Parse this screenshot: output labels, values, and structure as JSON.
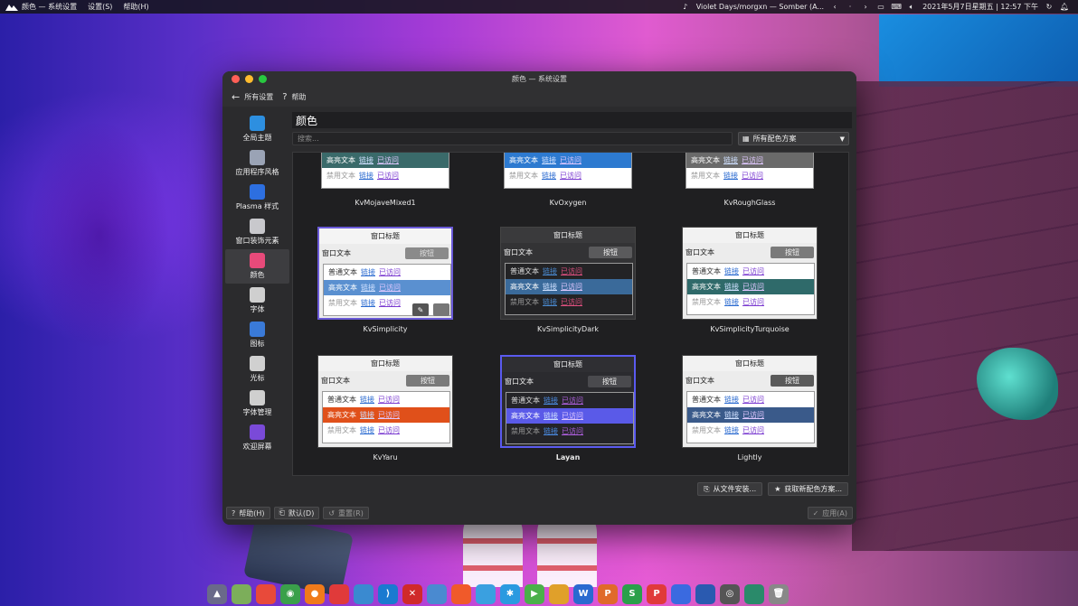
{
  "topbar": {
    "menu": [
      "颜色 — 系统设置",
      "设置(S)",
      "帮助(H)"
    ],
    "media": "Violet Days/morgxn — Somber (A...",
    "datetime": "2021年5月7日星期五 | 12:57 下午"
  },
  "window": {
    "title": "颜色 — 系统设置",
    "toolbar": {
      "back": "所有设置",
      "help": "帮助"
    },
    "sidebar": [
      {
        "label": "全局主题",
        "icon": "global-theme-icon",
        "color": "#2d8fe0"
      },
      {
        "label": "应用程序风格",
        "icon": "app-style-icon",
        "color": "#9aa3b5"
      },
      {
        "label": "Plasma 样式",
        "icon": "plasma-style-icon",
        "color": "#2d6fe0"
      },
      {
        "label": "窗口装饰元素",
        "icon": "window-decoration-icon",
        "color": "#c8c8cc"
      },
      {
        "label": "颜色",
        "icon": "colors-icon",
        "color": "#e84a7a",
        "active": true
      },
      {
        "label": "字体",
        "icon": "fonts-icon",
        "color": "#cfcfcf"
      },
      {
        "label": "图标",
        "icon": "icons-icon",
        "color": "#3a7ad8"
      },
      {
        "label": "光标",
        "icon": "cursor-icon",
        "color": "#d0d0d0"
      },
      {
        "label": "字体管理",
        "icon": "font-management-icon",
        "color": "#cfcfcf"
      },
      {
        "label": "欢迎屏幕",
        "icon": "splash-screen-icon",
        "color": "#7a4ad8"
      }
    ],
    "main": {
      "title": "颜色",
      "search_placeholder": "搜索...",
      "filter_label": "所有配色方案",
      "preview_text": {
        "window_title": "窗口标题",
        "window_text": "窗口文本",
        "button": "按钮",
        "normal": "普通文本",
        "highlight": "高亮文本",
        "disabled": "禁用文本",
        "link": "链接",
        "visited": "已访问"
      },
      "schemes_partial": [
        {
          "name": "KvMojaveMixed1",
          "hl": "#3a6a6a"
        },
        {
          "name": "KvOxygen",
          "hl": "#2d7ad0"
        },
        {
          "name": "KvRoughGlass",
          "hl": "#6a6a6a"
        }
      ],
      "schemes": [
        {
          "name": "KvSimplicity",
          "title_bg": "#f4f4f4",
          "title_fg": "#222",
          "bg": "#ececec",
          "fg": "#222",
          "btn": "#8a8a8a",
          "btn_fg": "#ddd",
          "view": "#ffffff",
          "view_fg": "#333",
          "hl": "#5a90d0",
          "link": "#2a6ad0",
          "visited": "#7a3ad0",
          "selected": true,
          "hover_buttons": true
        },
        {
          "name": "KvSimplicityDark",
          "title_bg": "#3a3a3c",
          "title_fg": "#eee",
          "bg": "#333335",
          "fg": "#eee",
          "btn": "#5a5a5c",
          "btn_fg": "#eee",
          "view": "#232325",
          "view_fg": "#ddd",
          "hl": "#3a6a9a",
          "link": "#4a8ad0",
          "visited": "#e05080"
        },
        {
          "name": "KvSimplicityTurquoise",
          "title_bg": "#f2f2f2",
          "title_fg": "#222",
          "bg": "#ececec",
          "fg": "#222",
          "btn": "#7a7a7a",
          "btn_fg": "#eee",
          "view": "#ffffff",
          "view_fg": "#333",
          "hl": "#2f6a6a",
          "link": "#2a6ad0",
          "visited": "#7a3ad0"
        },
        {
          "name": "KvYaru",
          "title_bg": "#f2f2f2",
          "title_fg": "#222",
          "bg": "#ececec",
          "fg": "#222",
          "btn": "#7a7a7a",
          "btn_fg": "#eee",
          "view": "#ffffff",
          "view_fg": "#333",
          "hl": "#e0501a",
          "link": "#2a6ad0",
          "visited": "#7a3ad0"
        },
        {
          "name": "Layan",
          "title_bg": "#2f2f33",
          "title_fg": "#eee",
          "bg": "#2b2b2f",
          "fg": "#eee",
          "btn": "#4a4a4e",
          "btn_fg": "#eee",
          "view": "#242428",
          "view_fg": "#ddd",
          "hl": "#5a5ae8",
          "link": "#4a8ae0",
          "visited": "#b060e0",
          "active": true
        },
        {
          "name": "Lightly",
          "title_bg": "#f2f2f2",
          "title_fg": "#222",
          "bg": "#ececec",
          "fg": "#222",
          "btn": "#5a5a5a",
          "btn_fg": "#eee",
          "view": "#ffffff",
          "view_fg": "#333",
          "hl": "#3a5a8a",
          "link": "#2a6ad0",
          "visited": "#7a3ad0"
        }
      ],
      "actions": {
        "install_file": "从文件安装...",
        "get_new": "获取新配色方案..."
      }
    },
    "footer": {
      "help": "帮助(H)",
      "defaults": "默认(D)",
      "reset": "重置(R)",
      "apply": "应用(A)"
    }
  },
  "dock": [
    {
      "icon": "launcher-icon",
      "color": "#6a6a8a"
    },
    {
      "icon": "files-icon",
      "color": "#7cae5a"
    },
    {
      "icon": "app-store-icon",
      "color": "#e84a3a"
    },
    {
      "icon": "chrome-icon",
      "color": "#3aa04a"
    },
    {
      "icon": "firefox-icon",
      "color": "#f07a1a"
    },
    {
      "icon": "weibo-icon",
      "color": "#e03a3a"
    },
    {
      "icon": "network-icon",
      "color": "#3a8ad0"
    },
    {
      "icon": "vscode-icon",
      "color": "#1a7ad0"
    },
    {
      "icon": "xmind-icon",
      "color": "#d02a2a"
    },
    {
      "icon": "cloud-icon",
      "color": "#4a8ad0"
    },
    {
      "icon": "editor-icon",
      "color": "#f05a2a"
    },
    {
      "icon": "chat-icon",
      "color": "#3aa0e0"
    },
    {
      "icon": "star-icon",
      "color": "#2a9ae0"
    },
    {
      "icon": "player-icon",
      "color": "#4ab04a"
    },
    {
      "icon": "bag-icon",
      "color": "#e0a02a"
    },
    {
      "icon": "word-icon",
      "color": "#2a6ad0"
    },
    {
      "icon": "presentation-icon",
      "color": "#e06a2a"
    },
    {
      "icon": "sheet-icon",
      "color": "#2aa04a"
    },
    {
      "icon": "pdf-icon",
      "color": "#e03a3a"
    },
    {
      "icon": "baidu-icon",
      "color": "#3a6ae0"
    },
    {
      "icon": "clipboard-icon",
      "color": "#2a5ab0"
    },
    {
      "icon": "aperture-icon",
      "color": "#555"
    },
    {
      "icon": "vpn-icon",
      "color": "#2a8a6a"
    },
    {
      "icon": "trash-icon",
      "color": "#888"
    }
  ]
}
